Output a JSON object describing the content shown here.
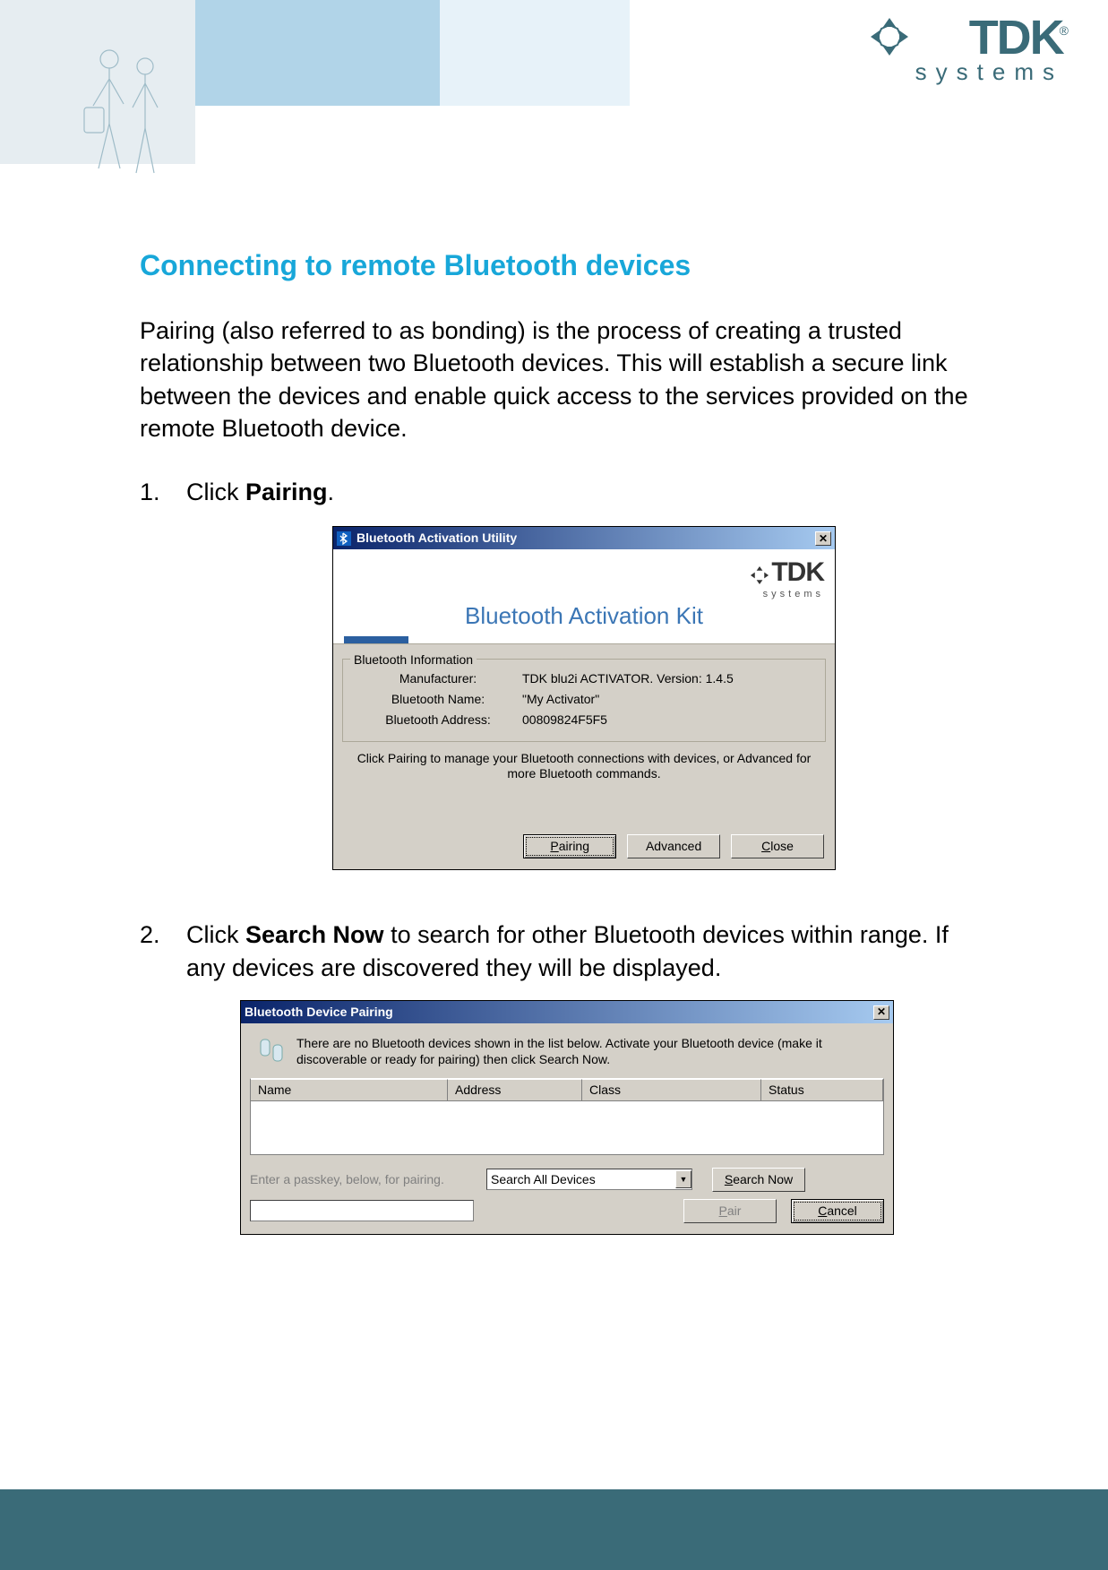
{
  "brand": {
    "name": "TDK",
    "sub": "systems",
    "reg": "®"
  },
  "page": {
    "title": "Connecting to remote Bluetooth devices",
    "intro": "Pairing (also referred to as bonding) is the process of creating a trusted relationship between two Bluetooth devices. This will establish a secure link between the devices and enable quick access to the services provided on the remote Bluetooth device."
  },
  "steps": {
    "s1_pre": "Click ",
    "s1_bold": "Pairing",
    "s1_post": ".",
    "s2_pre": "Click ",
    "s2_bold": "Search Now",
    "s2_post": " to search for other Bluetooth devices within range. If any devices are discovered they will be displayed."
  },
  "dialog1": {
    "title": "Bluetooth Activation Utility",
    "banner_title": "Bluetooth Activation Kit",
    "brand": {
      "name": "TDK",
      "sub": "systems"
    },
    "fieldset_legend": "Bluetooth Information",
    "rows": {
      "manufacturer_label": "Manufacturer:",
      "manufacturer_value": "TDK blu2i ACTIVATOR. Version: 1.4.5",
      "btname_label": "Bluetooth Name:",
      "btname_value": "\"My Activator\"",
      "btaddr_label": "Bluetooth Address:",
      "btaddr_value": "00809824F5F5"
    },
    "helper": "Click Pairing to manage your Bluetooth connections with devices, or Advanced for more Bluetooth commands.",
    "buttons": {
      "pairing": "Pairing",
      "advanced": "Advanced",
      "close": "Close"
    }
  },
  "dialog2": {
    "title": "Bluetooth Device Pairing",
    "message": "There are no Bluetooth devices shown in the list below. Activate your Bluetooth device (make it discoverable or ready for pairing) then click Search Now.",
    "columns": {
      "name": "Name",
      "address": "Address",
      "class": "Class",
      "status": "Status"
    },
    "hint": "Enter a passkey, below, for pairing.",
    "select_value": "Search All Devices",
    "buttons": {
      "search": "Search Now",
      "pair": "Pair",
      "cancel": "Cancel"
    }
  }
}
